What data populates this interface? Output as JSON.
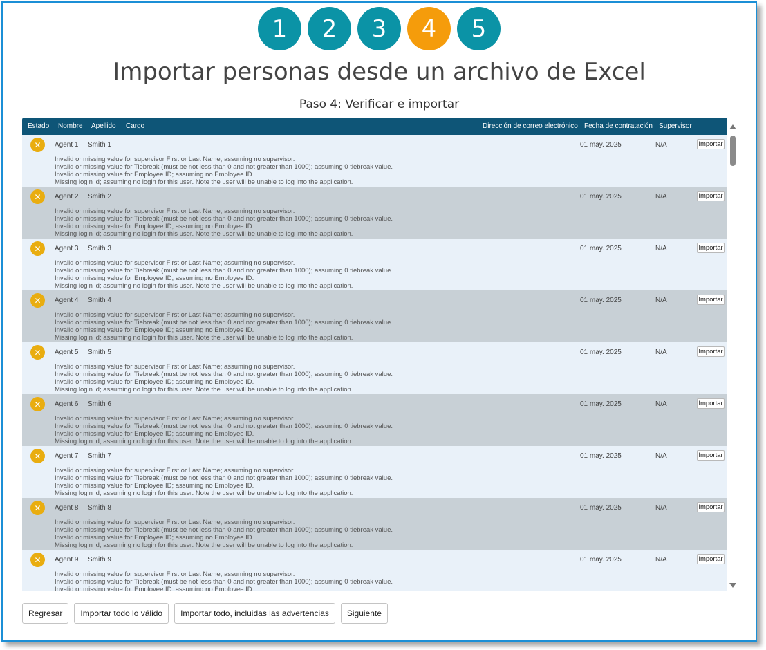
{
  "steps": [
    "1",
    "2",
    "3",
    "4",
    "5"
  ],
  "active_step": "4",
  "title": "Importar personas desde un archivo de Excel",
  "subtitle": "Paso 4: Verificar e importar",
  "table": {
    "headers": {
      "status": "Estado",
      "first_name": "Nombre",
      "last_name": "Apellido",
      "position": "Cargo",
      "email": "Dirección de correo electrónico",
      "hire_date": "Fecha de contratación",
      "supervisor": "Supervisor"
    },
    "status_icon": "error-x-icon",
    "row_colors": {
      "light": "#e9f1f9",
      "dark": "#c8d0d6"
    },
    "rows": [
      {
        "first_name": "Agent 1",
        "last_name": "Smith 1",
        "hire_date": "01 may. 2025",
        "supervisor": "N/A",
        "action": "Importar",
        "messages": [
          "Invalid or missing value for supervisor First or Last Name; assuming no supervisor.",
          "Invalid or missing value for Tiebreak (must be not less than 0 and not greater than 1000); assuming 0 tiebreak value.",
          "Invalid or missing value for Employee ID; assuming no Employee ID.",
          "Missing login id; assuming no login for this user. Note the user will be unable to log into the application."
        ]
      },
      {
        "first_name": "Agent 2",
        "last_name": "Smith 2",
        "hire_date": "01 may. 2025",
        "supervisor": "N/A",
        "action": "Importar",
        "messages": [
          "Invalid or missing value for supervisor First or Last Name; assuming no supervisor.",
          "Invalid or missing value for Tiebreak (must be not less than 0 and not greater than 1000); assuming 0 tiebreak value.",
          "Invalid or missing value for Employee ID; assuming no Employee ID.",
          "Missing login id; assuming no login for this user. Note the user will be unable to log into the application."
        ]
      },
      {
        "first_name": "Agent 3",
        "last_name": "Smith 3",
        "hire_date": "01 may. 2025",
        "supervisor": "N/A",
        "action": "Importar",
        "messages": [
          "Invalid or missing value for supervisor First or Last Name; assuming no supervisor.",
          "Invalid or missing value for Tiebreak (must be not less than 0 and not greater than 1000); assuming 0 tiebreak value.",
          "Invalid or missing value for Employee ID; assuming no Employee ID.",
          "Missing login id; assuming no login for this user. Note the user will be unable to log into the application."
        ]
      },
      {
        "first_name": "Agent 4",
        "last_name": "Smith 4",
        "hire_date": "01 may. 2025",
        "supervisor": "N/A",
        "action": "Importar",
        "messages": [
          "Invalid or missing value for supervisor First or Last Name; assuming no supervisor.",
          "Invalid or missing value for Tiebreak (must be not less than 0 and not greater than 1000); assuming 0 tiebreak value.",
          "Invalid or missing value for Employee ID; assuming no Employee ID.",
          "Missing login id; assuming no login for this user. Note the user will be unable to log into the application."
        ]
      },
      {
        "first_name": "Agent 5",
        "last_name": "Smith 5",
        "hire_date": "01 may. 2025",
        "supervisor": "N/A",
        "action": "Importar",
        "messages": [
          "Invalid or missing value for supervisor First or Last Name; assuming no supervisor.",
          "Invalid or missing value for Tiebreak (must be not less than 0 and not greater than 1000); assuming 0 tiebreak value.",
          "Invalid or missing value for Employee ID; assuming no Employee ID.",
          "Missing login id; assuming no login for this user. Note the user will be unable to log into the application."
        ]
      },
      {
        "first_name": "Agent 6",
        "last_name": "Smith 6",
        "hire_date": "01 may. 2025",
        "supervisor": "N/A",
        "action": "Importar",
        "messages": [
          "Invalid or missing value for supervisor First or Last Name; assuming no supervisor.",
          "Invalid or missing value for Tiebreak (must be not less than 0 and not greater than 1000); assuming 0 tiebreak value.",
          "Invalid or missing value for Employee ID; assuming no Employee ID.",
          "Missing login id; assuming no login for this user. Note the user will be unable to log into the application."
        ]
      },
      {
        "first_name": "Agent 7",
        "last_name": "Smith 7",
        "hire_date": "01 may. 2025",
        "supervisor": "N/A",
        "action": "Importar",
        "messages": [
          "Invalid or missing value for supervisor First or Last Name; assuming no supervisor.",
          "Invalid or missing value for Tiebreak (must be not less than 0 and not greater than 1000); assuming 0 tiebreak value.",
          "Invalid or missing value for Employee ID; assuming no Employee ID.",
          "Missing login id; assuming no login for this user. Note the user will be unable to log into the application."
        ]
      },
      {
        "first_name": "Agent 8",
        "last_name": "Smith 8",
        "hire_date": "01 may. 2025",
        "supervisor": "N/A",
        "action": "Importar",
        "messages": [
          "Invalid or missing value for supervisor First or Last Name; assuming no supervisor.",
          "Invalid or missing value for Tiebreak (must be not less than 0 and not greater than 1000); assuming 0 tiebreak value.",
          "Invalid or missing value for Employee ID; assuming no Employee ID.",
          "Missing login id; assuming no login for this user. Note the user will be unable to log into the application."
        ]
      },
      {
        "first_name": "Agent 9",
        "last_name": "Smith 9",
        "hire_date": "01 may. 2025",
        "supervisor": "N/A",
        "action": "Importar",
        "messages": [
          "Invalid or missing value for supervisor First or Last Name; assuming no supervisor.",
          "Invalid or missing value for Tiebreak (must be not less than 0 and not greater than 1000); assuming 0 tiebreak value.",
          "Invalid or missing value for Employee ID; assuming no Employee ID."
        ]
      }
    ]
  },
  "footer": {
    "back": "Regresar",
    "import_valid": "Importar todo lo válido",
    "import_all": "Importar todo, incluidas las advertencias",
    "next": "Siguiente"
  },
  "colors": {
    "step": "#0b93a6",
    "step_active": "#f59c0b",
    "header_bg": "#0e5577",
    "status_icon": "#e9ad10",
    "frame_border": "#1b8fd6"
  }
}
